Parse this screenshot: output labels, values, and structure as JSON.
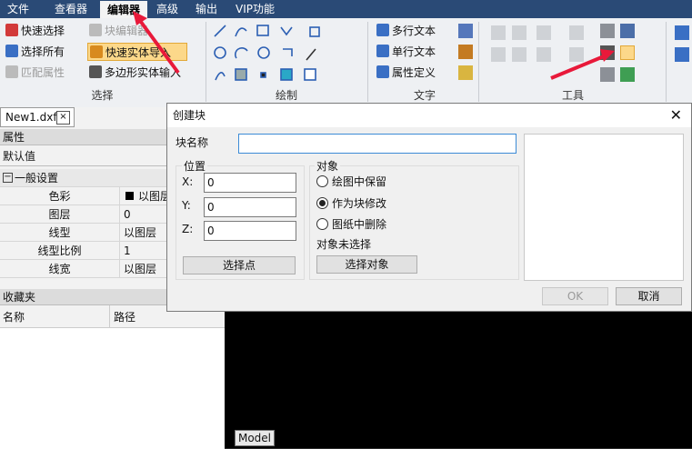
{
  "menu": [
    "文件",
    "查看器",
    "编辑器",
    "高级",
    "输出",
    "VIP功能"
  ],
  "ribbon": {
    "select_group": {
      "label": "选择",
      "items": [
        "快速选择",
        "选择所有",
        "匹配属性",
        "块编辑器",
        "快速实体导入",
        "多边形实体输入"
      ]
    },
    "draw_group": {
      "label": "绘制"
    },
    "text_group": {
      "label": "文字",
      "items": [
        "多行文本",
        "单行文本",
        "属性定义"
      ]
    },
    "tools_group": {
      "label": "工具"
    }
  },
  "doc_tab": {
    "name": "New1.dxf",
    "close": "×"
  },
  "properties": {
    "header": "属性",
    "default_row": "默认值",
    "section": "一般设置",
    "rows": [
      {
        "k": "色彩",
        "v": "以图层"
      },
      {
        "k": "图层",
        "v": "0"
      },
      {
        "k": "线型",
        "v": "以图层"
      },
      {
        "k": "线型比例",
        "v": "1"
      },
      {
        "k": "线宽",
        "v": "以图层"
      }
    ]
  },
  "favorites": {
    "header": "收藏夹",
    "col_name": "名称",
    "col_path": "路径"
  },
  "model_tab": "Model",
  "dialog": {
    "title": "创建块",
    "close": "✕",
    "block_name_label": "块名称",
    "block_name_value": "",
    "position": {
      "label": "位置",
      "x_label": "X:",
      "x": "0",
      "y_label": "Y:",
      "y": "0",
      "z_label": "Z:",
      "z": "0",
      "pick_button": "选择点"
    },
    "objects": {
      "label": "对象",
      "options": [
        "绘图中保留",
        "作为块修改",
        "图纸中删除"
      ],
      "selected_index": 1,
      "status": "对象未选择",
      "select_button": "选择对象"
    },
    "ok": "OK",
    "cancel": "取消"
  },
  "colors": {
    "menubar": "#2a4a76",
    "annotation": "#e8193a",
    "canvas": "#000000"
  }
}
